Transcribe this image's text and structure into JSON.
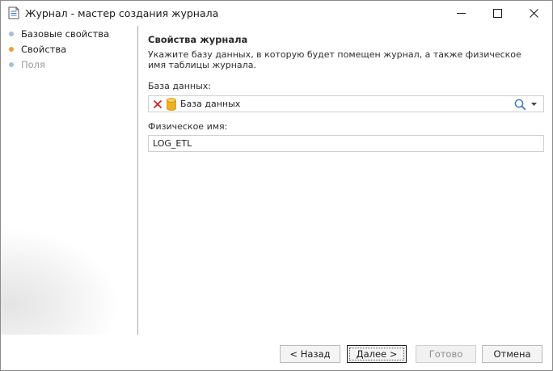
{
  "window": {
    "title": "Журнал - мастер создания журнала",
    "icon": "document-icon"
  },
  "nav": {
    "items": [
      {
        "label": "Базовые свойства",
        "state": "completed",
        "dot_color": "#a9bfd6"
      },
      {
        "label": "Свойства",
        "state": "current",
        "dot_color": "#f0a030"
      },
      {
        "label": "Поля",
        "state": "pending",
        "dot_color": "#a9bfd6"
      }
    ]
  },
  "main": {
    "title": "Свойства журнала",
    "description": "Укажите базу данных, в которую будет помещен журнал, а также физическое имя таблицы журнала.",
    "database": {
      "label": "База данных:",
      "value": "База данных",
      "icons": [
        "clear-icon",
        "database-icon",
        "search-icon",
        "chevron-down-icon"
      ]
    },
    "physical_name": {
      "label": "Физическое имя:",
      "value": "LOG_ETL"
    }
  },
  "footer": {
    "back": "< Назад",
    "next": "Далее >",
    "done": "Готово",
    "cancel": "Отмена"
  },
  "colors": {
    "accent": "#f0a030",
    "clear_red": "#d32020",
    "database_gold": "#f0b020"
  }
}
